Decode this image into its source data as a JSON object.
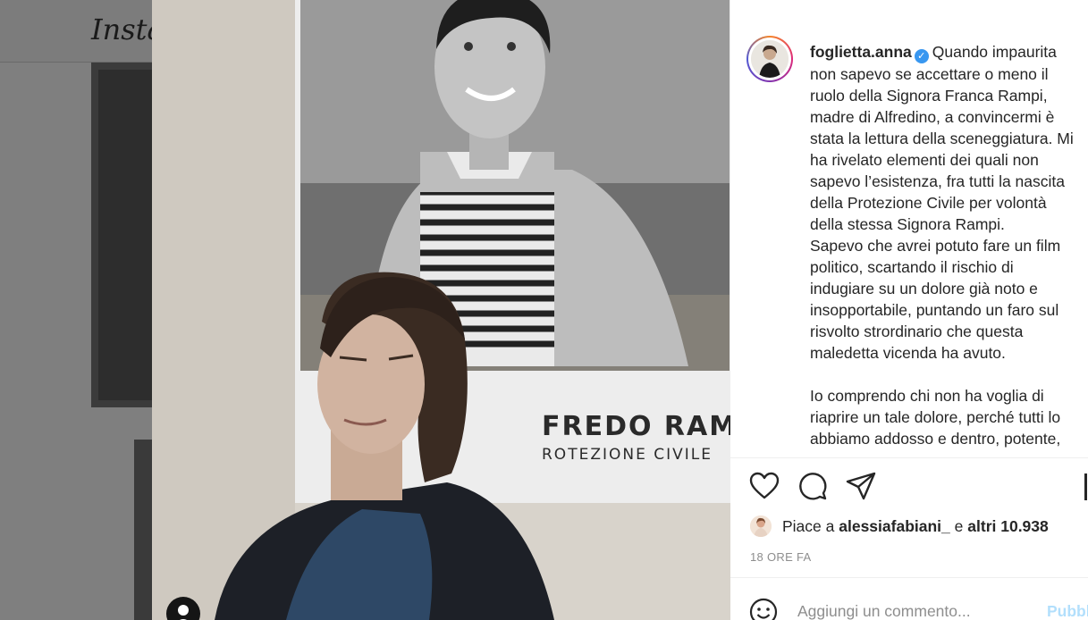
{
  "background": {
    "logo_text": "Insta"
  },
  "photo": {
    "poster_name": "FREDO RAMPI",
    "poster_subtitle": "ROTEZIONE CIVILE"
  },
  "post": {
    "username": "foglietta.anna",
    "caption_paragraphs": [
      "Quando impaurita non sapevo se accettare o meno il ruolo della Signora Franca Rampi, madre di Alfredino, a convincermi è stata la lettura della sceneggiatura. Mi ha rivelato elementi dei quali non sapevo l’esistenza, fra tutti la nascita della Protezione Civile per volontà della stessa Signora Rampi.",
      "Sapevo che avrei potuto fare un film politico, scartando il rischio di indugiare su un dolore già noto e insopportabile, puntando un faro sul risvolto strordinario che questa maledetta vicenda ha avuto.",
      "Io comprendo chi non ha voglia di riaprire un tale dolore, perché tutti lo abbiamo addosso e dentro, potente,"
    ],
    "likes": {
      "prefix": "Piace a",
      "liker": "alessiafabiani_",
      "joiner": "e",
      "others": "altri 10.938"
    },
    "timestamp": "18 ORE FA",
    "comment": {
      "placeholder": "Aggiungi un commento...",
      "publish_label": "Pubblica"
    }
  },
  "colors": {
    "verified": "#3897f0",
    "publish": "#b2dffc"
  }
}
